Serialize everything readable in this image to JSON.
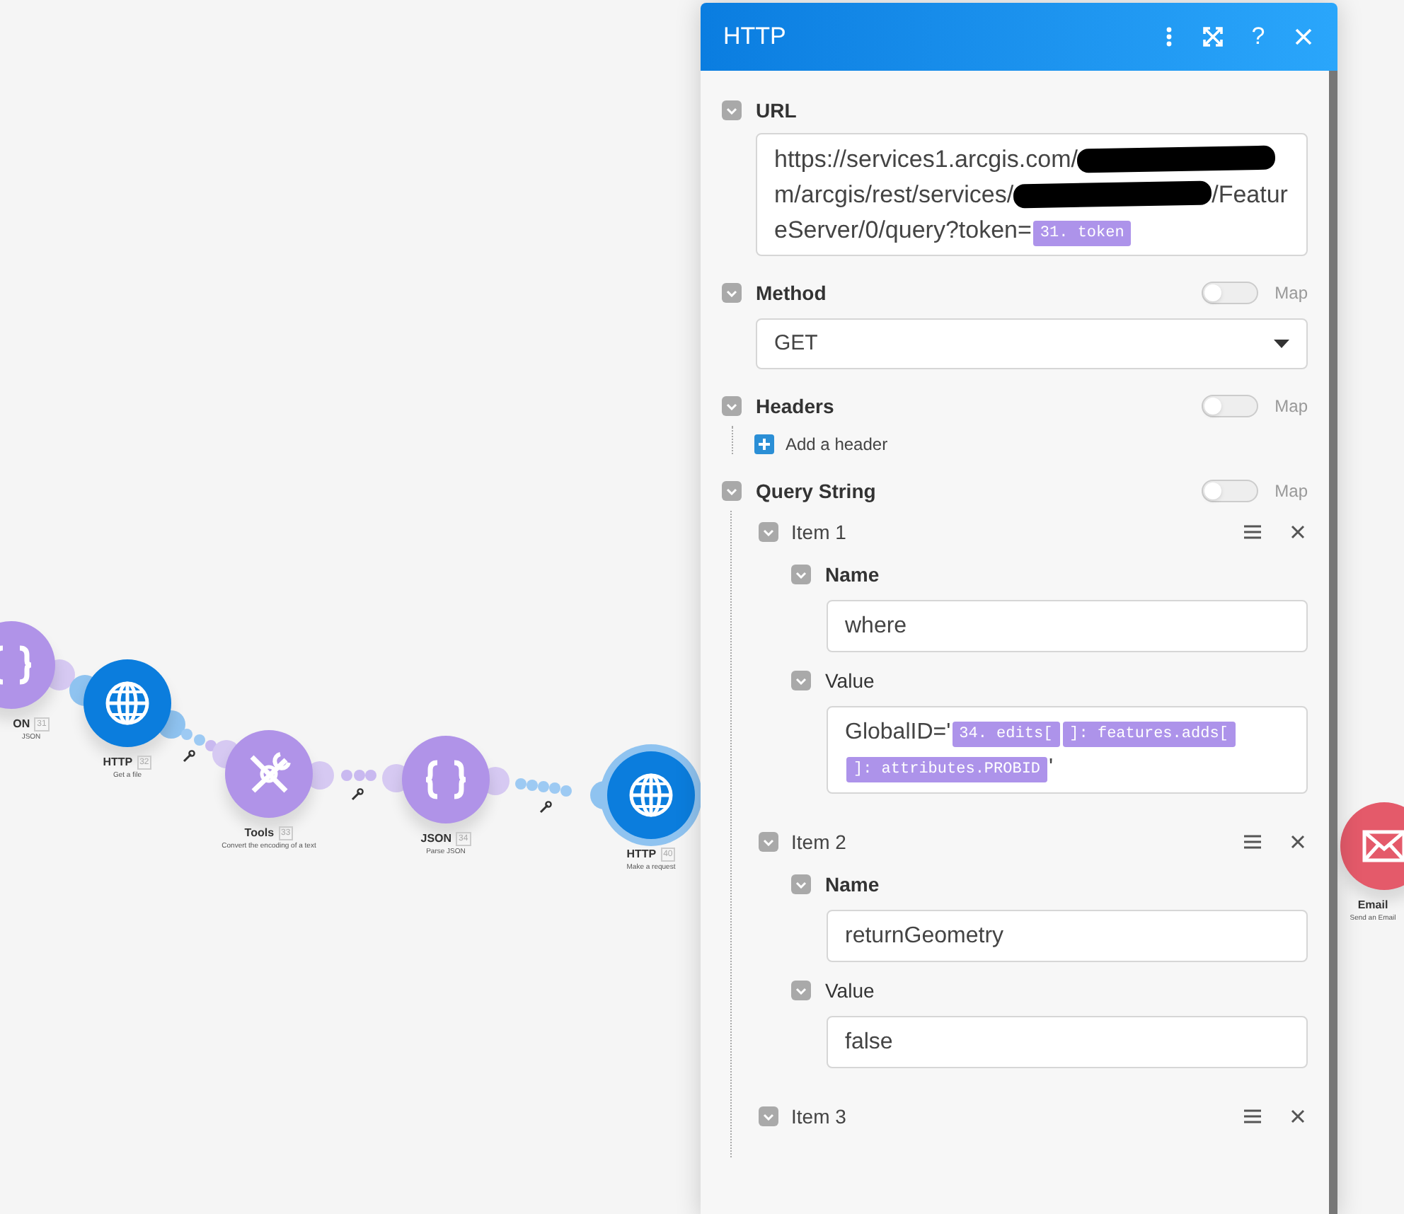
{
  "canvas": {
    "modules": [
      {
        "kind": "json",
        "title": "ON",
        "badge": "31",
        "subtitle": "JSON",
        "selected": false
      },
      {
        "kind": "http",
        "title": "HTTP",
        "badge": "32",
        "subtitle": "Get a file",
        "selected": false
      },
      {
        "kind": "tools",
        "title": "Tools",
        "badge": "33",
        "subtitle": "Convert the encoding of a text",
        "selected": false
      },
      {
        "kind": "json",
        "title": "JSON",
        "badge": "34",
        "subtitle": "Parse JSON",
        "selected": false
      },
      {
        "kind": "http",
        "title": "HTTP",
        "badge": "40",
        "subtitle": "Make a request",
        "selected": true
      },
      {
        "kind": "email",
        "title": "Email",
        "subtitle": "Send an Email",
        "selected": false
      }
    ]
  },
  "panel": {
    "title": "HTTP",
    "help": "?",
    "sections": [
      {
        "kind": "url",
        "label": "URL",
        "segments": [
          {
            "kind": "text",
            "text": "https://services1.arcgis.com/"
          },
          {
            "kind": "redacted"
          },
          {
            "kind": "text",
            "text": "m/arcgis/rest/services/"
          },
          {
            "kind": "redacted"
          },
          {
            "kind": "text",
            "text": "/FeatureServer/0/query?token="
          },
          {
            "kind": "pill",
            "text": "31. token"
          }
        ]
      },
      {
        "kind": "select",
        "label": "Method",
        "map": {
          "label": "Map",
          "on": false
        },
        "value": "GET"
      },
      {
        "kind": "list",
        "label": "Headers",
        "map": {
          "label": "Map",
          "on": false
        },
        "add_label": "Add a header"
      },
      {
        "kind": "items",
        "label": "Query String",
        "map": {
          "label": "Map",
          "on": false
        },
        "items": [
          {
            "label": "Item 1",
            "fields": [
              {
                "label": "Name",
                "segments": [
                  {
                    "kind": "text",
                    "text": "where"
                  }
                ]
              },
              {
                "label": "Value",
                "segments": [
                  {
                    "kind": "text",
                    "text": "GlobalID='"
                  },
                  {
                    "kind": "pill",
                    "text": "34. edits["
                  },
                  {
                    "kind": "pill",
                    "text": "]: features.adds["
                  },
                  {
                    "kind": "pill",
                    "text": "]: attributes.PROBID"
                  },
                  {
                    "kind": "text",
                    "text": "'"
                  }
                ]
              }
            ]
          },
          {
            "label": "Item 2",
            "fields": [
              {
                "label": "Name",
                "segments": [
                  {
                    "kind": "text",
                    "text": "returnGeometry"
                  }
                ]
              },
              {
                "label": "Value",
                "segments": [
                  {
                    "kind": "text",
                    "text": "false"
                  }
                ]
              }
            ]
          },
          {
            "label": "Item 3"
          }
        ]
      }
    ]
  }
}
